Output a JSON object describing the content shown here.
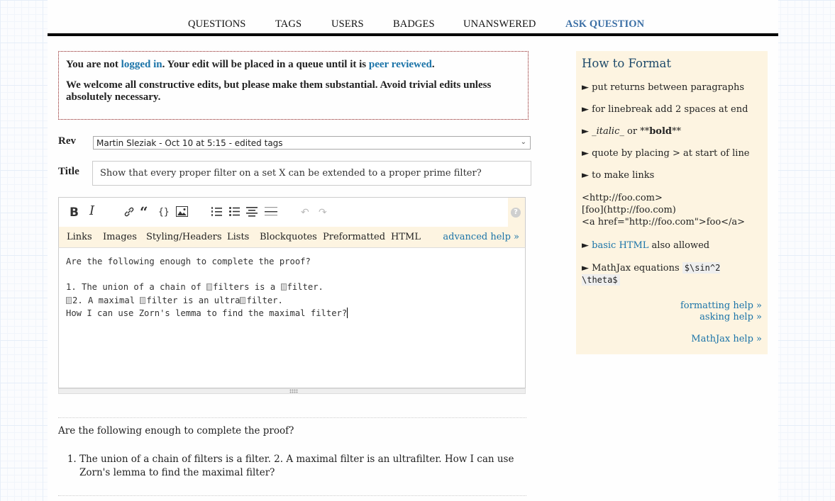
{
  "nav": {
    "items": [
      {
        "label": "QUESTIONS"
      },
      {
        "label": "TAGS"
      },
      {
        "label": "USERS"
      },
      {
        "label": "BADGES"
      },
      {
        "label": "UNANSWERED"
      },
      {
        "label": "ASK QUESTION"
      }
    ]
  },
  "notice": {
    "line1_prefix": "You are not ",
    "logged_in_link": "logged in",
    "line1_middle": ". Your edit will be placed in a queue until it is ",
    "peer_reviewed_link": "peer reviewed",
    "line1_suffix": ".",
    "line2": "We welcome all constructive edits, but please make them substantial. Avoid trivial edits unless absolutely necessary."
  },
  "form": {
    "rev_label": "Rev",
    "rev_selected": "Martin Sleziak - Oct 10 at 5:15 - edited tags",
    "title_label": "Title",
    "title_value": "Show that every proper filter on a set X can be extended to a proper prime filter?"
  },
  "editor": {
    "toolbar": {
      "bold": "B",
      "italic": "I",
      "link": "🔗",
      "quote": "❝",
      "code": "{}",
      "image": "▨",
      "olist": "☰",
      "ulist": "☰",
      "heading": "☰",
      "hr": "☰",
      "undo": "↶",
      "redo": "↷",
      "help": "?"
    },
    "help_tabs": [
      "Links",
      "Images",
      "Styling/Headers",
      "Lists",
      "Blockquotes",
      "Preformatted",
      "HTML"
    ],
    "advanced_help": "advanced help »",
    "lines": [
      "Are the following enough to complete the proof?",
      "",
      "1. The union of a chain of ",
      "filters is a ",
      "filter.",
      "2. A maximal ",
      "filter is an ultra",
      "filter.",
      "How I can use Zorn's lemma to find the maximal filter?"
    ]
  },
  "preview": {
    "paragraph": "Are the following enough to complete the proof?",
    "list_items": [
      "The union of a chain of filters is a filter. 2. A maximal filter is an ultrafilter. How I can use Zorn's lemma to find the maximal filter?"
    ]
  },
  "sidebar": {
    "title": "How to Format",
    "bullet": "►",
    "items": {
      "returns": "put returns between paragraphs",
      "linebreak": "for linebreak add 2 spaces at end",
      "italic_pre": "_",
      "italic_word": "italic",
      "italic_post": "_",
      "or": " or ",
      "bold_pre": "**",
      "bold_word": "bold",
      "bold_post": "**",
      "quote": "quote by placing > at start of line",
      "links": "to make links"
    },
    "link_examples": [
      "<http://foo.com>",
      "[foo](http://foo.com)",
      "<a href=\"http://foo.com\">foo</a>"
    ],
    "basic_html_link": "basic HTML",
    "basic_html_suffix": " also allowed",
    "mathjax_prefix": "MathJax equations ",
    "mathjax_code": "$\\sin^2 \\theta$",
    "footer_links": [
      "formatting help »",
      "asking help »",
      "MathJax help »"
    ]
  },
  "colors": {
    "link": "#1a73a8",
    "nav_ask": "#3b6fa5",
    "notice_border": "#8b1a1a",
    "sidebar_bg": "#fdf4e1"
  }
}
